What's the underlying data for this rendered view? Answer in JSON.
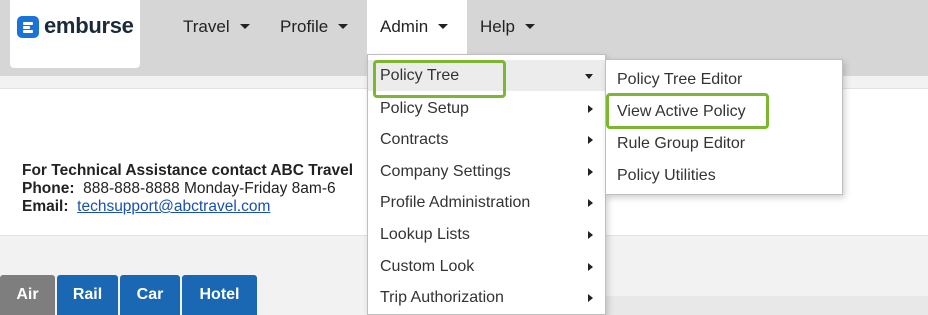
{
  "brand": {
    "logo_text": "emburse",
    "accent": "#1a73d6"
  },
  "nav": {
    "items": [
      {
        "label": "Travel"
      },
      {
        "label": "Profile"
      },
      {
        "label": "Admin"
      },
      {
        "label": "Help"
      }
    ]
  },
  "contact": {
    "heading": "For Technical Assistance contact ABC Travel",
    "phone_label": "Phone:",
    "phone_value": "888-888-8888 Monday-Friday 8am-6",
    "email_label": "Email:",
    "email_value": "techsupport@abctravel.com"
  },
  "tabs": [
    {
      "label": "Air",
      "active": true
    },
    {
      "label": "Rail",
      "active": false
    },
    {
      "label": "Car",
      "active": false
    },
    {
      "label": "Hotel",
      "active": false
    }
  ],
  "admin_menu": {
    "items": [
      {
        "label": "Policy Tree"
      },
      {
        "label": "Policy Setup"
      },
      {
        "label": "Contracts"
      },
      {
        "label": "Company Settings"
      },
      {
        "label": "Profile Administration"
      },
      {
        "label": "Lookup Lists"
      },
      {
        "label": "Custom Look"
      },
      {
        "label": "Trip Authorization"
      }
    ]
  },
  "policy_tree_submenu": {
    "items": [
      {
        "label": "Policy Tree Editor"
      },
      {
        "label": "View Active Policy"
      },
      {
        "label": "Rule Group Editor"
      },
      {
        "label": "Policy Utilities"
      }
    ]
  },
  "colors": {
    "highlight_outline": "#7cb82f",
    "tab_active": "#7e7e7e",
    "tab_normal": "#1a68b3"
  }
}
